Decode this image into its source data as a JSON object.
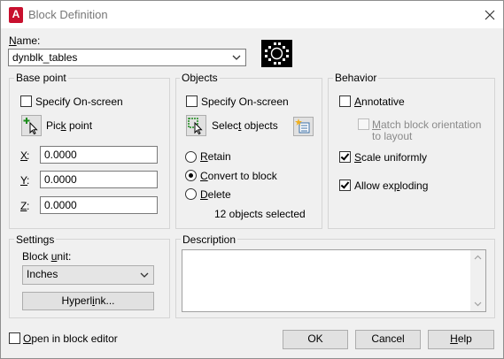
{
  "window": {
    "title": "Block Definition",
    "app_icon": "A",
    "accent": "#c8102e"
  },
  "name": {
    "label_underlined": "N",
    "label_rest": "ame:",
    "value": "dynblk_tables"
  },
  "base_point": {
    "title": "Base point",
    "specify_onscreen": "Specify On-screen",
    "pick_point_u": "Pic",
    "pick_point_k": "k",
    "pick_point_rest": " point",
    "x_label": "X",
    "y_label": "Y",
    "z_label": "Z",
    "x": "0.0000",
    "y": "0.0000",
    "z": "0.0000"
  },
  "objects": {
    "title": "Objects",
    "specify_onscreen": "Specify On-screen",
    "select_objects_pre": "Selec",
    "select_objects_u": "t",
    "select_objects_post": " objects",
    "retain_u": "R",
    "retain_rest": "etain",
    "convert_u": "C",
    "convert_rest": "onvert to block",
    "delete_u": "D",
    "delete_rest": "elete",
    "count_text": "12 objects selected"
  },
  "behavior": {
    "title": "Behavior",
    "annotative_u": "A",
    "annotative_rest": "nnotative",
    "match_u": "M",
    "match_rest": "atch block orientation",
    "match_line2": "to layout",
    "scale_u": "S",
    "scale_rest": "cale uniformly",
    "explode_pre": "Allow ex",
    "explode_u": "p",
    "explode_post": "loding"
  },
  "settings": {
    "title": "Settings",
    "block_unit_pre": "Block ",
    "block_unit_u": "u",
    "block_unit_post": "nit:",
    "unit_value": "Inches",
    "hyperlink_pre": "Hyperl",
    "hyperlink_u": "i",
    "hyperlink_post": "nk..."
  },
  "description": {
    "title": "Description",
    "value": ""
  },
  "footer": {
    "open_editor_u": "O",
    "open_editor_rest": "pen in block editor",
    "ok": "OK",
    "cancel": "Cancel",
    "help_u": "H",
    "help_rest": "elp"
  }
}
